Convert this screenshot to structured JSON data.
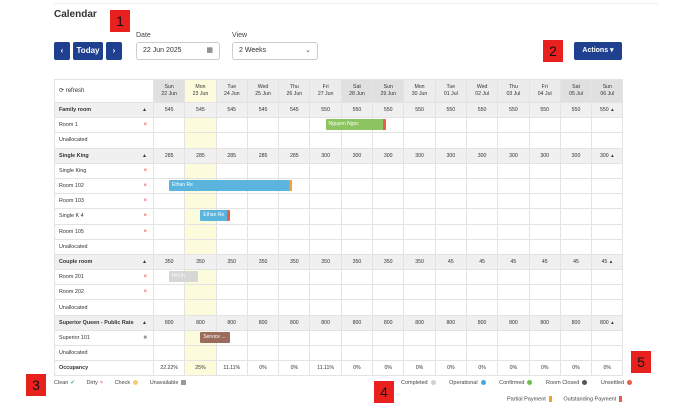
{
  "page": {
    "title": "Calendar"
  },
  "badges": [
    "1",
    "2",
    "3",
    "4",
    "5"
  ],
  "toolbar": {
    "prev_label": "‹",
    "today_label": "Today",
    "next_label": "›",
    "date_label": "Date",
    "date_value": "22 Jun 2025",
    "view_label": "View",
    "view_value": "2 Weeks",
    "actions_label": "Actions"
  },
  "grid": {
    "refresh_label": "refresh",
    "days": [
      {
        "dow": "Sun",
        "date": "22 Jun"
      },
      {
        "dow": "Mon",
        "date": "23 Jun"
      },
      {
        "dow": "Tue",
        "date": "24 Jun"
      },
      {
        "dow": "Wed",
        "date": "25 Jun"
      },
      {
        "dow": "Thu",
        "date": "26 Jun"
      },
      {
        "dow": "Fri",
        "date": "27 Jun"
      },
      {
        "dow": "Sat",
        "date": "28 Jun"
      },
      {
        "dow": "Sun",
        "date": "29 Jun"
      },
      {
        "dow": "Mon",
        "date": "30 Jun"
      },
      {
        "dow": "Tue",
        "date": "01 Jul"
      },
      {
        "dow": "Wed",
        "date": "02 Jul"
      },
      {
        "dow": "Thu",
        "date": "03 Jul"
      },
      {
        "dow": "Fri",
        "date": "04 Jul"
      },
      {
        "dow": "Sat",
        "date": "05 Jul"
      },
      {
        "dow": "Sun",
        "date": "06 Jul"
      }
    ],
    "rows": [
      {
        "type": "group",
        "name": "Family room",
        "values": [
          "545",
          "545",
          "545",
          "545",
          "545",
          "550",
          "550",
          "550",
          "550",
          "550",
          "550",
          "550",
          "550",
          "550",
          "550"
        ]
      },
      {
        "type": "room",
        "name": "Room 1",
        "mark": "×"
      },
      {
        "type": "room",
        "name": "Unallocated",
        "mark": ""
      },
      {
        "type": "group",
        "name": "Single King",
        "values": [
          "285",
          "285",
          "285",
          "285",
          "285",
          "300",
          "300",
          "300",
          "300",
          "300",
          "300",
          "300",
          "300",
          "300",
          "300"
        ]
      },
      {
        "type": "room",
        "name": "Single King",
        "mark": "×"
      },
      {
        "type": "room",
        "name": "Room 102",
        "mark": "×"
      },
      {
        "type": "room",
        "name": "Room 103",
        "mark": "×"
      },
      {
        "type": "room",
        "name": "Single K 4",
        "mark": "×"
      },
      {
        "type": "room",
        "name": "Room 105",
        "mark": "×"
      },
      {
        "type": "room",
        "name": "Unallocated",
        "mark": ""
      },
      {
        "type": "group",
        "name": "Couple room",
        "values": [
          "350",
          "350",
          "350",
          "350",
          "350",
          "350",
          "350",
          "350",
          "350",
          "45",
          "45",
          "45",
          "45",
          "45",
          "45"
        ]
      },
      {
        "type": "room",
        "name": "Room 201",
        "mark": "×"
      },
      {
        "type": "room",
        "name": "Room 202",
        "mark": "×"
      },
      {
        "type": "room",
        "name": "Unallocated",
        "mark": ""
      },
      {
        "type": "group",
        "name": "Superior Queen - Public Rate",
        "values": [
          "800",
          "800",
          "800",
          "800",
          "800",
          "800",
          "800",
          "800",
          "800",
          "800",
          "800",
          "800",
          "800",
          "800",
          "800"
        ]
      },
      {
        "type": "room",
        "name": "Superior 101",
        "mark": "■"
      },
      {
        "type": "room",
        "name": "Unallocated",
        "mark": ""
      },
      {
        "type": "occ",
        "name": "Occupancy",
        "values": [
          "22.22%",
          "25%",
          "11.11%",
          "0%",
          "0%",
          "11.11%",
          "0%",
          "0%",
          "0%",
          "0%",
          "0%",
          "0%",
          "0%",
          "0%",
          "0%"
        ]
      }
    ],
    "bookings": [
      {
        "label": "Nguyen Ngoc",
        "row": 1,
        "start": 5,
        "span": 2,
        "color": "#8cc461",
        "end": "#e85d4a"
      },
      {
        "label": "Ethan Re",
        "row": 5,
        "start": 0,
        "span": 4,
        "color": "#5ab4de",
        "end": "#f0a030"
      },
      {
        "label": "Ethan Re",
        "row": 7,
        "start": 1,
        "span": 1,
        "color": "#5ab4de",
        "end": "#e85d4a"
      },
      {
        "label": "Hi Lin",
        "row": 11,
        "start": 0,
        "span": 1,
        "color": "#d7d7d7",
        "end": ""
      },
      {
        "label": "Service ...",
        "row": 15,
        "start": 1,
        "span": 1,
        "color": "#9b6b5e",
        "end": ""
      }
    ]
  },
  "legend": {
    "clean": "Clean",
    "dirty": "Dirty",
    "check": "Check",
    "unavailable": "Unavailable",
    "completed": "Completed",
    "operational": "Operational",
    "confirmed": "Confirmed",
    "room_closed": "Room Closed",
    "unsettled": "Unsettled",
    "partial_payment": "Partial Payment",
    "outstanding_payment": "Outstanding Payment",
    "colors": {
      "clean": "#4caf50",
      "dirty": "#e53935",
      "check": "#f6c977",
      "unavailable": "#999999",
      "completed": "#d0d0d0",
      "operational": "#4aa8d8",
      "confirmed": "#6cc04a",
      "room_closed": "#555555",
      "unsettled": "#e85d4a",
      "partial_payment": "#f0a030",
      "outstanding_payment": "#e85d4a"
    }
  }
}
